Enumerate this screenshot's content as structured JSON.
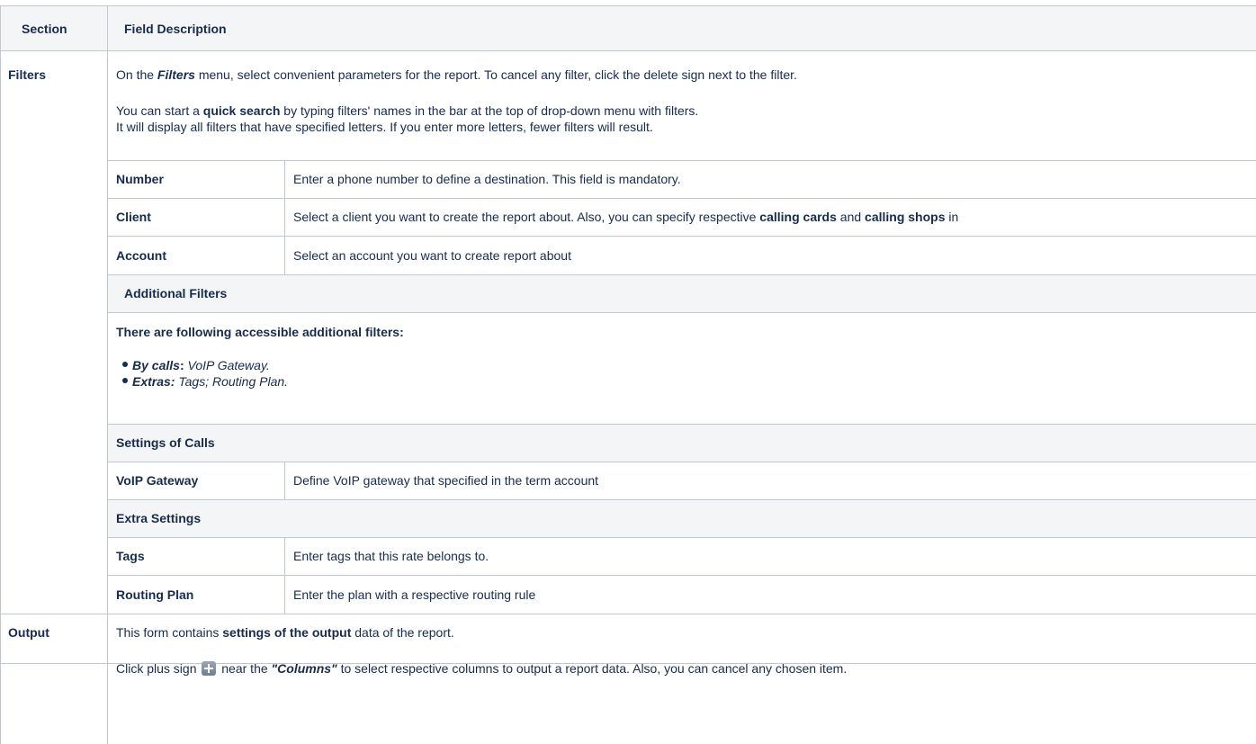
{
  "header": {
    "section": "Section",
    "field_description": "Field Description"
  },
  "filters": {
    "section_label": "Filters",
    "intro": {
      "p1": "On the ",
      "em": "Filters",
      "p2": " menu, select convenient parameters for the report. To cancel any filter, click the delete sign  next to the filter."
    },
    "quick_search": {
      "line1_a": "You can start a ",
      "line1_b": "quick search",
      "line1_c": " by typing filters' names in the bar at the top of drop-down menu with filters.",
      "line2": "It will display all filters that have specified letters. If you enter more letters, fewer filters will result."
    },
    "rows": [
      {
        "name": "Number",
        "desc_a": "Enter a phone number to define a destination. This field is mandatory."
      },
      {
        "name": "Client",
        "desc_a": "Select a client you want to create the report about. Also, you can specify respective ",
        "desc_b": "calling cards",
        "desc_c": " and ",
        "desc_d": "calling shops",
        "desc_e": " in"
      },
      {
        "name": "Account",
        "desc_a": "Select an account you want to create report about"
      }
    ],
    "additional": {
      "header": "Additional Filters",
      "lead": "There are following accessible additional filters:",
      "bullets": [
        {
          "label": "By calls",
          "sep": ":",
          "value": " VoIP Gateway."
        },
        {
          "label": "Extras:",
          "sep": "",
          "value": " Tags; Routing Plan."
        }
      ]
    },
    "settings_of_calls": {
      "header": "Settings of Calls",
      "rows": [
        {
          "name": "VoIP Gateway",
          "desc": "Define VoIP gateway that specified in the term account"
        }
      ]
    },
    "extra_settings": {
      "header": "Extra Settings",
      "rows": [
        {
          "name": "Tags",
          "desc": "Enter tags that this rate belongs to."
        },
        {
          "name": "Routing Plan",
          "desc": "Enter the plan with a respective routing rule"
        }
      ]
    }
  },
  "output": {
    "section_label": "Output",
    "line1_a": "This form contains ",
    "line1_b": "settings of the output",
    "line1_c": " data of the report.",
    "line2_a": "Click plus sign ",
    "line2_icon": "plus-icon",
    "line2_b": " near the ",
    "line2_c": "\"Columns\"",
    "line2_d": " to select respective columns to output a report data. Also, you can cancel any chosen item."
  }
}
